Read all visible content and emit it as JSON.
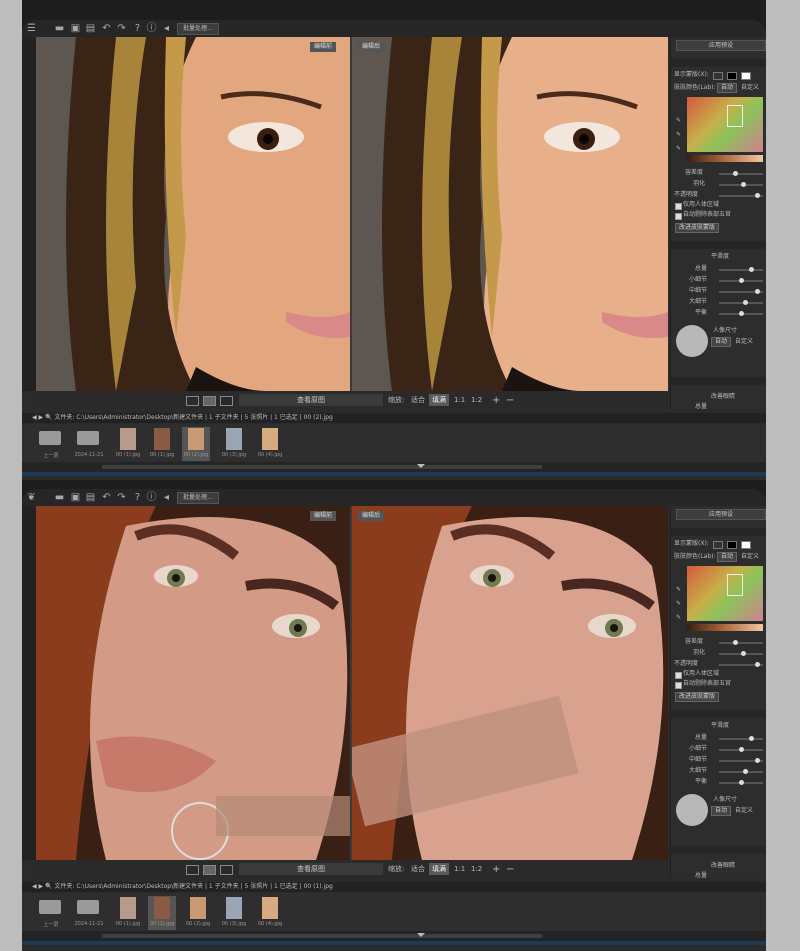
{
  "screens": [
    {
      "toolbar": {
        "batch_label": "批量处理..."
      },
      "viewer": {
        "before_tag": "编辑前",
        "after_tag": "编辑后"
      },
      "viewbar": {
        "view_original": "查看原图",
        "zoom_label": "缩放:",
        "fit": "适合",
        "fill": "填满",
        "r11": "1:1",
        "r12": "1:2",
        "plus": "+",
        "minus": "−"
      },
      "pathbar": {
        "text": "◀ ▶ 🔍 文件夹: C:\\Users\\Administrator\\Desktop\\新建文件夹 | 1 子文件夹 | 5 张照片 | 1 已选定 | 00 (2).jpg"
      },
      "filmstrip": {
        "up_label": "上一层",
        "folder_label": "2024-11-21",
        "thumbs": [
          "00 (1).jpg",
          "00 (1).jpg",
          "00 (2).jpg",
          "00 (3).jpg",
          "00 (4).jpg"
        ],
        "selected_index": 2
      },
      "rightpanel": {
        "preset": "应用预设",
        "mask_label": "显示蒙版(X):",
        "skin_color_label": "肤肤颜色(Lab):",
        "auto": "自动",
        "custom": "自定义",
        "tolerance": "容差度",
        "feather": "羽化",
        "opacity": "不透明度",
        "only_face": "仅用人体区域",
        "auto_remove": "自动剔除表部五官",
        "change_mask": "改进皮肤蒙版",
        "smooth": "平滑度",
        "s1": "总量",
        "s2": "小细节",
        "s3": "中细节",
        "s4": "大细节",
        "s5": "平衡",
        "face_size": "人像尺寸",
        "auto2": "自动",
        "custom2": "自定义",
        "enhance": "改善眼睛",
        "total": "总量"
      }
    },
    {
      "toolbar": {
        "batch_label": "批量处理..."
      },
      "viewer": {
        "before_tag": "编辑前",
        "after_tag": "编辑后"
      },
      "viewbar": {
        "view_original": "查看原图",
        "zoom_label": "缩放:",
        "fit": "适合",
        "fill": "填满",
        "r11": "1:1",
        "r12": "1:2",
        "plus": "+",
        "minus": "−"
      },
      "pathbar": {
        "text": "◀ ▶ 🔍 文件夹: C:\\Users\\Administrator\\Desktop\\新建文件夹 | 1 子文件夹 | 5 张照片 | 1 已选定 | 00 (1).jpg"
      },
      "filmstrip": {
        "up_label": "上一层",
        "folder_label": "2024-11-21",
        "thumbs": [
          "00 (1).jpg",
          "00 (1).jpg",
          "00 (2).jpg",
          "00 (3).jpg",
          "00 (4).jpg"
        ],
        "selected_index": 1
      },
      "rightpanel": {
        "preset": "应用预设",
        "mask_label": "显示蒙版(X):",
        "skin_color_label": "肤肤颜色(Lab):",
        "auto": "自动",
        "custom": "自定义",
        "tolerance": "容差度",
        "feather": "羽化",
        "opacity": "不透明度",
        "only_face": "仅用人体区域",
        "auto_remove": "自动剔除表部五官",
        "change_mask": "改进皮肤蒙版",
        "smooth": "平滑度",
        "s1": "总量",
        "s2": "小细节",
        "s3": "中细节",
        "s4": "大细节",
        "s5": "平衡",
        "face_size": "人像尺寸",
        "auto2": "自动",
        "custom2": "自定义",
        "enhance": "改善眼睛",
        "total": "总量"
      }
    }
  ],
  "colors": {
    "app_bg": "#2b2b2b",
    "selection": "#5a5a5a",
    "accent_bar": "#1e3a55"
  }
}
